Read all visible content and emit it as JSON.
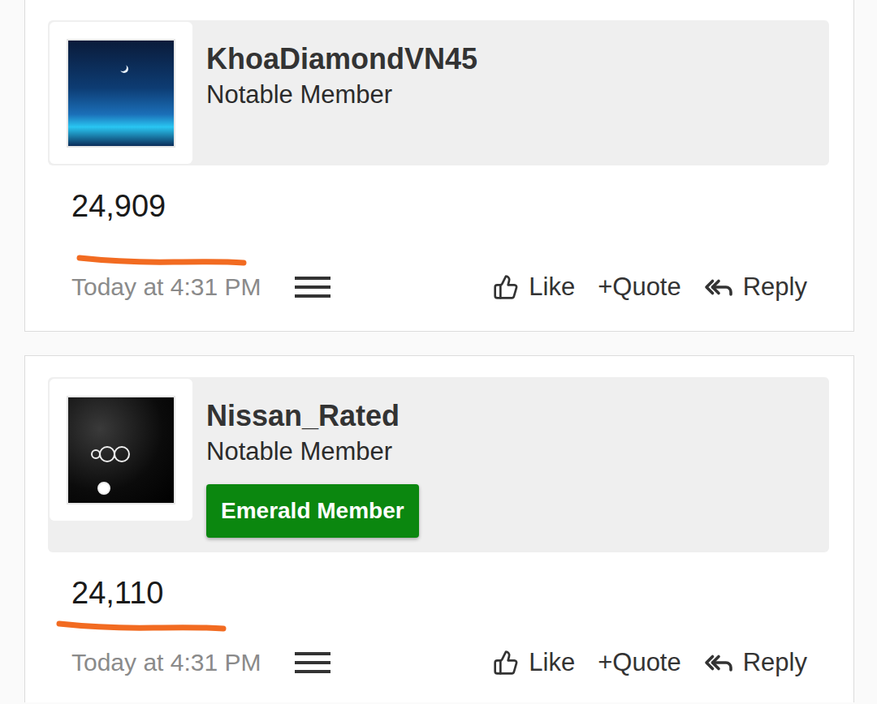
{
  "posts": [
    {
      "author": "KhoaDiamondVN45",
      "title": "Notable Member",
      "badges": [],
      "body": "24,909",
      "underlined": true,
      "time": "Today at 4:31 PM",
      "actions": [
        "Like",
        "+Quote",
        "Reply"
      ]
    },
    {
      "author": "Nissan_Rated",
      "title": "Notable Member",
      "badges": [
        "Emerald Member"
      ],
      "body": "24,110",
      "underlined": true,
      "time": "Today at 4:31 PM",
      "actions": [
        "Like",
        "+Quote",
        "Reply"
      ]
    }
  ]
}
